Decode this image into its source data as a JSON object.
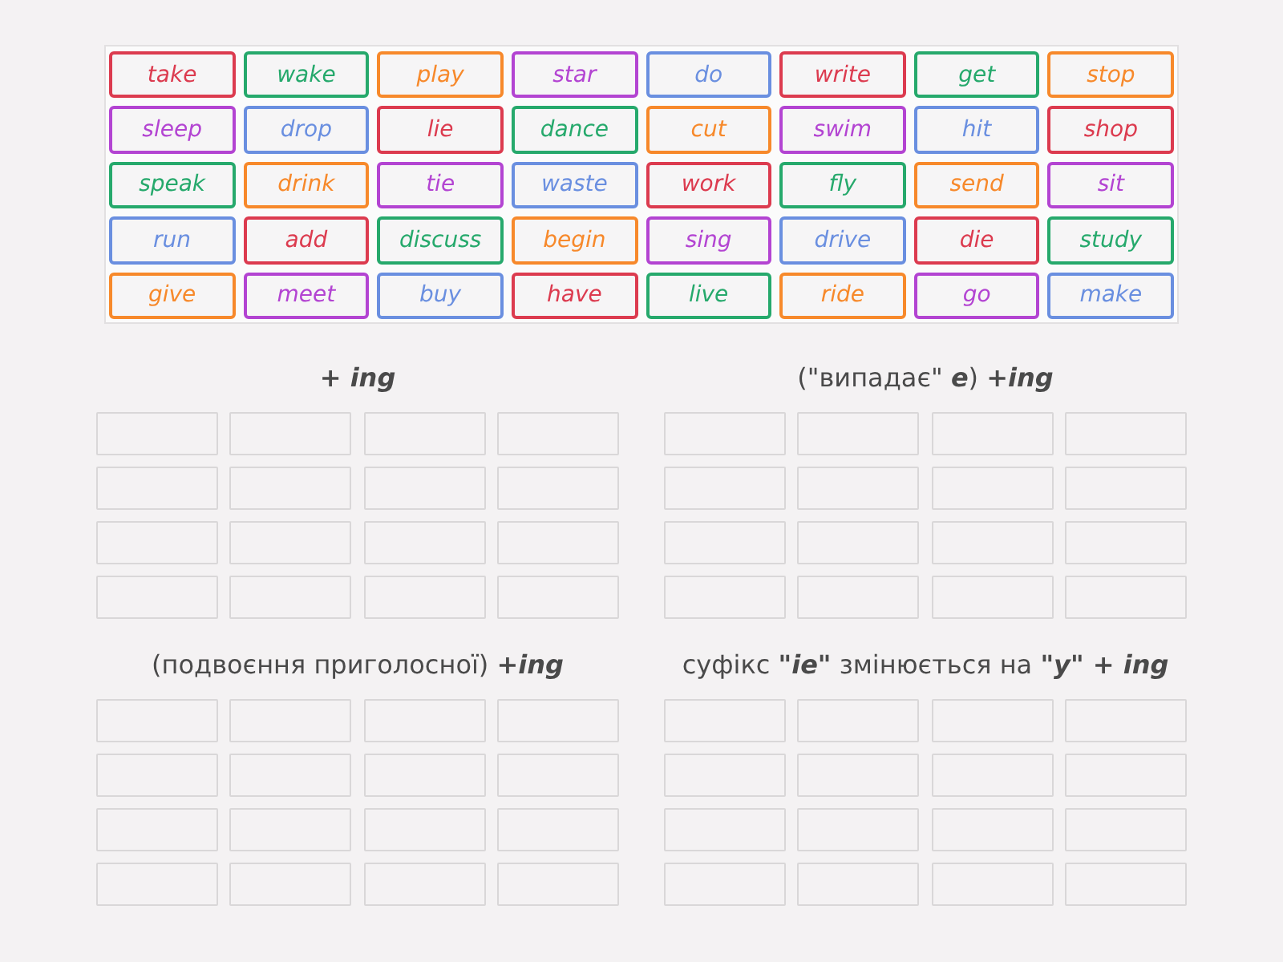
{
  "word_bank": {
    "tiles": [
      {
        "word": "take",
        "color": "#dc3b4f"
      },
      {
        "word": "wake",
        "color": "#26a96c"
      },
      {
        "word": "play",
        "color": "#f7892b"
      },
      {
        "word": "star",
        "color": "#b344d2"
      },
      {
        "word": "do",
        "color": "#6a8fe0"
      },
      {
        "word": "write",
        "color": "#dc3b4f"
      },
      {
        "word": "get",
        "color": "#26a96c"
      },
      {
        "word": "stop",
        "color": "#f7892b"
      },
      {
        "word": "sleep",
        "color": "#b344d2"
      },
      {
        "word": "drop",
        "color": "#6a8fe0"
      },
      {
        "word": "lie",
        "color": "#dc3b4f"
      },
      {
        "word": "dance",
        "color": "#26a96c"
      },
      {
        "word": "cut",
        "color": "#f7892b"
      },
      {
        "word": "swim",
        "color": "#b344d2"
      },
      {
        "word": "hit",
        "color": "#6a8fe0"
      },
      {
        "word": "shop",
        "color": "#dc3b4f"
      },
      {
        "word": "speak",
        "color": "#26a96c"
      },
      {
        "word": "drink",
        "color": "#f7892b"
      },
      {
        "word": "tie",
        "color": "#b344d2"
      },
      {
        "word": "waste",
        "color": "#6a8fe0"
      },
      {
        "word": "work",
        "color": "#dc3b4f"
      },
      {
        "word": "fly",
        "color": "#26a96c"
      },
      {
        "word": "send",
        "color": "#f7892b"
      },
      {
        "word": "sit",
        "color": "#b344d2"
      },
      {
        "word": "run",
        "color": "#6a8fe0"
      },
      {
        "word": "add",
        "color": "#dc3b4f"
      },
      {
        "word": "discuss",
        "color": "#26a96c"
      },
      {
        "word": "begin",
        "color": "#f7892b"
      },
      {
        "word": "sing",
        "color": "#b344d2"
      },
      {
        "word": "drive",
        "color": "#6a8fe0"
      },
      {
        "word": "die",
        "color": "#dc3b4f"
      },
      {
        "word": "study",
        "color": "#26a96c"
      },
      {
        "word": "give",
        "color": "#f7892b"
      },
      {
        "word": "meet",
        "color": "#b344d2"
      },
      {
        "word": "buy",
        "color": "#6a8fe0"
      },
      {
        "word": "have",
        "color": "#dc3b4f"
      },
      {
        "word": "live",
        "color": "#26a96c"
      },
      {
        "word": "ride",
        "color": "#f7892b"
      },
      {
        "word": "go",
        "color": "#b344d2"
      },
      {
        "word": "make",
        "color": "#6a8fe0"
      }
    ]
  },
  "groups": [
    {
      "heading": "+ ing",
      "italic": true,
      "slots": [
        {
          "kind": "empty"
        },
        {
          "kind": "empty"
        },
        {
          "kind": "empty"
        },
        {
          "kind": "empty"
        },
        {
          "kind": "empty"
        },
        {
          "kind": "empty"
        },
        {
          "kind": "empty"
        },
        {
          "kind": "empty"
        },
        {
          "kind": "empty"
        },
        {
          "kind": "empty"
        },
        {
          "kind": "empty"
        },
        {
          "kind": "empty"
        },
        {
          "kind": "empty"
        },
        {
          "kind": "empty"
        },
        {
          "kind": "empty"
        },
        {
          "kind": "empty"
        }
      ]
    },
    {
      "heading": "(\"випадає\" *e*) *+ing*",
      "italic": false,
      "slots": [
        {
          "kind": "empty"
        },
        {
          "kind": "empty"
        },
        {
          "kind": "empty"
        },
        {
          "kind": "empty"
        },
        {
          "kind": "empty"
        },
        {
          "kind": "empty"
        },
        {
          "kind": "empty"
        },
        {
          "kind": "empty"
        },
        {
          "kind": "empty"
        },
        {
          "kind": "empty"
        },
        {
          "kind": "empty"
        },
        {
          "kind": "empty"
        },
        {
          "kind": "empty"
        },
        {
          "kind": "empty"
        },
        {
          "kind": "empty"
        },
        {
          "kind": "empty"
        }
      ]
    },
    {
      "heading": "(подвоєння приголосної) *+ing*",
      "italic": false,
      "slots": [
        {
          "kind": "empty"
        },
        {
          "kind": "empty"
        },
        {
          "kind": "empty"
        },
        {
          "kind": "empty"
        },
        {
          "kind": "empty"
        },
        {
          "kind": "empty"
        },
        {
          "kind": "empty"
        },
        {
          "kind": "empty"
        },
        {
          "kind": "empty"
        },
        {
          "kind": "empty"
        },
        {
          "kind": "empty"
        },
        {
          "kind": "empty"
        },
        {
          "kind": "empty"
        },
        {
          "kind": "empty"
        },
        {
          "kind": "empty"
        },
        {
          "kind": "empty"
        }
      ]
    },
    {
      "heading": "суфікс *\"ie\"* змінюється на *\"y\" + ing*",
      "italic": false,
      "slots": [
        {
          "kind": "empty"
        },
        {
          "kind": "empty"
        },
        {
          "kind": "empty"
        },
        {
          "kind": "empty"
        },
        {
          "kind": "empty"
        },
        {
          "kind": "empty"
        },
        {
          "kind": "empty"
        },
        {
          "kind": "empty"
        },
        {
          "kind": "empty"
        },
        {
          "kind": "empty"
        },
        {
          "kind": "empty"
        },
        {
          "kind": "empty"
        },
        {
          "kind": "empty"
        },
        {
          "kind": "empty"
        },
        {
          "kind": "empty"
        },
        {
          "kind": "empty"
        }
      ]
    }
  ]
}
